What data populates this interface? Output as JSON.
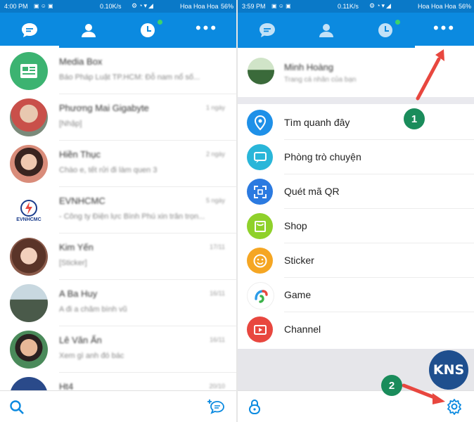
{
  "left": {
    "status": {
      "time": "4:00 PM",
      "speed": "0.10K/s",
      "carrier": "Hoa Hoa Hoa",
      "battery": "56%"
    },
    "tabs": [
      "chat-bubble-icon",
      "contacts-icon",
      "timeline-clock-icon",
      "more-dots-icon"
    ],
    "chats": [
      {
        "name": "Media Box",
        "preview": "Báo Pháp Luật TP.HCM: Đỗ nam nổ số...",
        "time": "",
        "avatar_color": "#3cb371"
      },
      {
        "name": "Phương Mai Gigabyte",
        "preview": "[Nhập]",
        "time": "1 ngày",
        "avatar_color": "#c9504a"
      },
      {
        "name": "Hiền Thục",
        "preview": "Chào e, tết rửi đi làm quen 3",
        "time": "2 ngày",
        "avatar_color": "#d98c7a"
      },
      {
        "name": "EVNHCMC",
        "preview": "- Công ty Điện lực Bình Phú xin trân trọn...",
        "time": "5 ngày",
        "avatar_color": "#ffffff"
      },
      {
        "name": "Kim Yến",
        "preview": "[Sticker]",
        "time": "17/11",
        "avatar_color": "#8a5a4a"
      },
      {
        "name": "A Ba Huy",
        "preview": "A đi a chăm bình vũ",
        "time": "16/11",
        "avatar_color": "#5a6a5a"
      },
      {
        "name": "Lê Văn Ẩn",
        "preview": "Xem gì anh đó bác",
        "time": "16/11",
        "avatar_color": "#4a8a5a"
      },
      {
        "name": "Ht4",
        "preview": "",
        "time": "20/10",
        "avatar_color": "#2a4a8a"
      }
    ],
    "bottom": [
      "search-icon",
      "new-chat-icon"
    ]
  },
  "right": {
    "status": {
      "time": "3:59 PM",
      "speed": "0.11K/s",
      "carrier": "Hoa Hoa Hoa",
      "battery": "56%"
    },
    "profile": {
      "name": "Minh Hoàng",
      "subtitle": "Trang cá nhân của bạn"
    },
    "menu": [
      {
        "label": "Tìm quanh đây",
        "icon": "location-pin-icon",
        "color": "#1e90e8"
      },
      {
        "label": "Phòng trò chuyện",
        "icon": "chat-room-icon",
        "color": "#29b6d9"
      },
      {
        "label": "Quét mã QR",
        "icon": "qr-scan-icon",
        "color": "#2b7ae0"
      },
      {
        "label": "Shop",
        "icon": "shop-icon",
        "color": "#8fd12b"
      },
      {
        "label": "Sticker",
        "icon": "sticker-icon",
        "color": "#f5a623"
      },
      {
        "label": "Game",
        "icon": "game-icon",
        "color": "#ffffff"
      },
      {
        "label": "Channel",
        "icon": "channel-icon",
        "color": "#e8473f"
      }
    ],
    "kns_logo": "KNS",
    "callouts": [
      "1",
      "2"
    ]
  },
  "evn_logo_text": "EVNHCMC",
  "colors": {
    "navbar": "#0b8ae0",
    "statusbar": "#0a79c8",
    "accent_arrow": "#e8473f",
    "callout": "#1a8c5b"
  }
}
